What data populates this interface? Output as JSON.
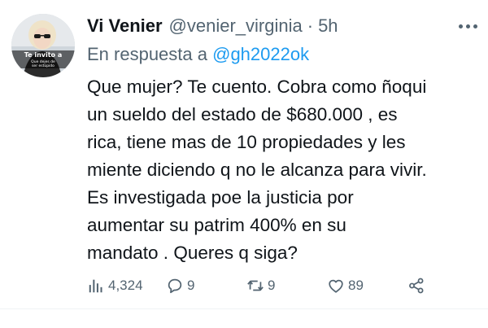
{
  "tweet": {
    "author_name": "Vi Venier",
    "author_handle": "@venier_virginia",
    "separator": "·",
    "time": "5h",
    "reply_prefix": "En respuesta a",
    "reply_handle": "@gh2022ok",
    "text_lines": [
      "Que mujer? Te cuento. Cobra como ñoqui",
      "un sueldo del estado de $680.000 , es",
      "rica, tiene mas de 10 propiedades y les",
      "miente diciendo q no le alcanza para vivir.",
      "Es investigada poe la justicia por",
      "aumentar su patrim 400% en su",
      "mandato . Queres q siga?"
    ],
    "avatar_text": [
      "Te invito a",
      "Que dejes de",
      "ser estúpido"
    ]
  },
  "actions": {
    "views": {
      "icon": "views-icon",
      "count": "4,324"
    },
    "replies": {
      "icon": "reply-icon",
      "count": "9"
    },
    "retweets": {
      "icon": "retweet-icon",
      "count": "9"
    },
    "likes": {
      "icon": "heart-icon",
      "count": "89"
    },
    "share": {
      "icon": "share-icon"
    }
  },
  "colors": {
    "text": "#0f1419",
    "secondary": "#536471",
    "link": "#1d9bf0",
    "divider": "#eff3f4"
  }
}
